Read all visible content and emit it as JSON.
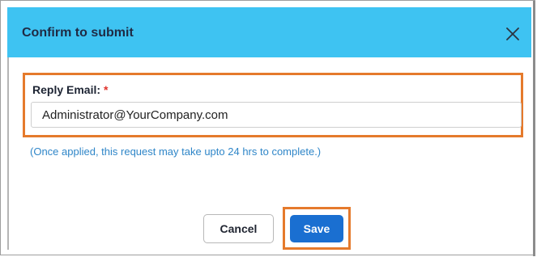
{
  "dialog": {
    "title": "Confirm to submit",
    "close_icon": "close-icon"
  },
  "form": {
    "reply_email_label": "Reply Email:",
    "required_marker": "*",
    "reply_email_value": "Administrator@YourCompany.com",
    "note": "(Once applied, this request may take upto 24 hrs to complete.)"
  },
  "actions": {
    "cancel_label": "Cancel",
    "save_label": "Save"
  },
  "colors": {
    "header_bg": "#3ec3f2",
    "highlight_outline": "#e57a2c",
    "primary_button": "#1a6fd1",
    "note_text": "#2f86c8",
    "required_marker": "#e0332c"
  }
}
